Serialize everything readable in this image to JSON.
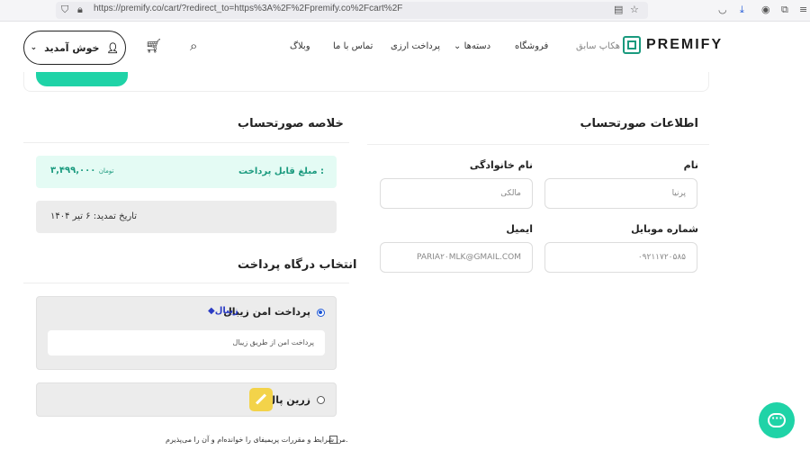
{
  "browser": {
    "url": "https://premify.co/cart/?redirect_to=https%3A%2F%2Fpremify.co%2Fcart%2F"
  },
  "header": {
    "welcome_label": "خوش آمدید",
    "logo_text": "PREMIFY",
    "logo_sub": "هکاپ سابق",
    "nav": [
      "فروشگاه",
      "دسته‌ها",
      "پرداخت ارزی",
      "تماس با ما",
      "وبلاگ"
    ]
  },
  "billing": {
    "title": "اطلاعات صورتحساب",
    "first_name_label": "نام",
    "first_name_value": "پرنیا",
    "last_name_label": "نام خانوادگی",
    "last_name_value": "مالکی",
    "mobile_label": "شماره موبایل",
    "mobile_value": "۰۹۲۱۱۷۲۰۵۸۵",
    "email_label": "ایمیل",
    "email_value": "PARIA۲۰MLK@GMAIL.COM"
  },
  "summary": {
    "title": "خلاصه صورتحساب",
    "payable_label": "مبلغ قابل پرداخت :",
    "payable_amount": "۳,۴۹۹,۰۰۰",
    "currency": "تومان",
    "renewal": "تاریخ تمدید: ۶ تیر ۱۴۰۴"
  },
  "gateway": {
    "title": "انتخاب درگاه پرداخت",
    "options": [
      {
        "name": "پرداخت امن زیبال",
        "logo": "زیبال",
        "desc": "پرداخت امن از طریق زیبال",
        "selected": true
      },
      {
        "name": "زرین پال",
        "selected": false
      }
    ]
  },
  "terms": "من شرایط و مقررات پریمیفای را خوانده‌ام و آن را می‌پذیرم.",
  "colors": {
    "accent": "#1fd3a7",
    "accent_dark": "#1a9a7e",
    "selected": "#1c56d6",
    "zarin": "#f3d34a"
  }
}
